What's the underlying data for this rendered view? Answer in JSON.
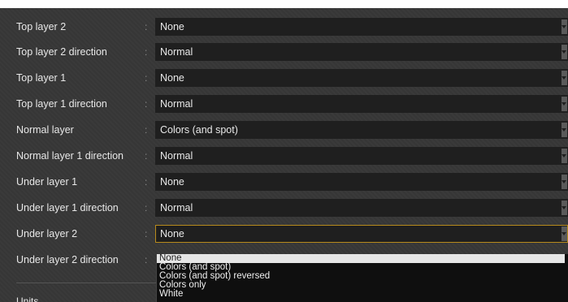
{
  "rows": [
    {
      "label": "Top layer 2",
      "value": "None"
    },
    {
      "label": "Top layer 2 direction",
      "value": "Normal"
    },
    {
      "label": "Top layer 1",
      "value": "None"
    },
    {
      "label": "Top layer 1 direction",
      "value": "Normal"
    },
    {
      "label": "Normal layer",
      "value": "Colors (and spot)"
    },
    {
      "label": "Normal layer 1 direction",
      "value": "Normal"
    },
    {
      "label": "Under layer 1",
      "value": "None"
    },
    {
      "label": "Under layer 1 direction",
      "value": "Normal"
    },
    {
      "label": "Under layer 2",
      "value": "None"
    },
    {
      "label": "Under layer 2 direction",
      "value": ""
    }
  ],
  "separator": ":",
  "units_label": "Units",
  "dropdown": {
    "options": [
      "None",
      "Colors (and spot)",
      "Colors (and spot) reversed",
      "Colors only",
      "White"
    ],
    "selected": "None"
  },
  "colors": {
    "focus_border": "#b78a1c",
    "panel_bg": "#3a3a3a",
    "field_bg": "#1f1f1f"
  }
}
